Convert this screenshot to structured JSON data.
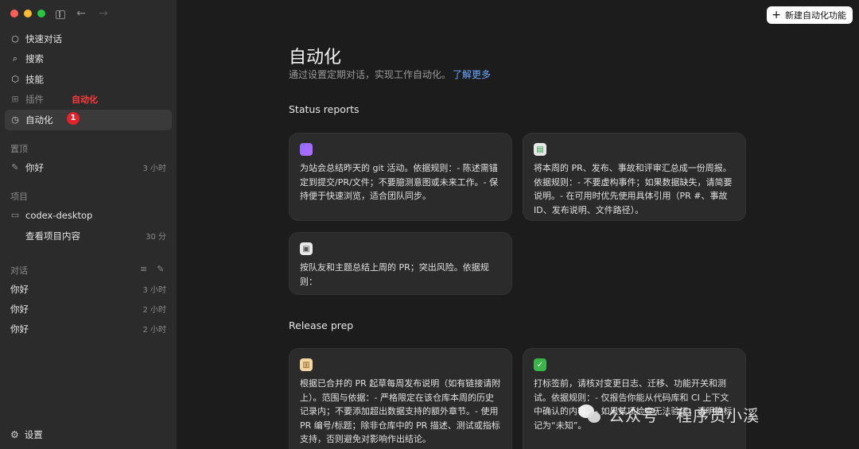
{
  "window": {
    "traffic_lights": [
      "#fe5f57",
      "#febc2e",
      "#28c840"
    ]
  },
  "sidebar": {
    "nav": [
      {
        "label": "快速对话",
        "icon": "chat-bubble-icon"
      },
      {
        "label": "搜索",
        "icon": "search-icon"
      },
      {
        "label": "技能",
        "icon": "cube-icon"
      },
      {
        "label": "插件",
        "icon": "grid-icon"
      },
      {
        "label": "自动化",
        "icon": "clock-icon"
      }
    ],
    "annotation_label": "自动化",
    "annotation_badge": "1",
    "pinned": {
      "header": "置顶",
      "items": [
        {
          "label": "你好",
          "meta": "3 小时"
        }
      ]
    },
    "projects": {
      "header": "项目",
      "items": [
        {
          "label": "codex-desktop",
          "meta": ""
        },
        {
          "label": "查看项目内容",
          "meta": "30 分"
        }
      ]
    },
    "conversations": {
      "header": "对话",
      "items": [
        {
          "label": "你好",
          "meta": "3 小时"
        },
        {
          "label": "你好",
          "meta": "2 小时"
        },
        {
          "label": "你好",
          "meta": "2 小时"
        }
      ]
    },
    "settings_label": "设置"
  },
  "main": {
    "new_button": "新建自动化功能",
    "title": "自动化",
    "subtitle": "通过设置定期对话，实现工作自动化。",
    "learn_more": "了解更多",
    "sections": [
      {
        "title": "Status reports",
        "cards": [
          {
            "icon": "purple-blob-icon",
            "text": "为站会总结昨天的 git 活动。依据规则：- 陈述需锚定到提交/PR/文件；不要臆测意图或未来工作。- 保持便于快速浏览，适合团队同步。"
          },
          {
            "icon": "document-icon",
            "text": "将本周的 PR、发布、事故和评审汇总成一份周报。依据规则：- 不要虚构事件；如果数据缺失，请简要说明。- 在可用时优先使用具体引用（PR #、事故 ID、发布说明、文件路径）。"
          },
          {
            "icon": "id-card-icon",
            "text": "按队友和主题总结上周的 PR；突出风险。依据规则："
          }
        ]
      },
      {
        "title": "Release prep",
        "cards": [
          {
            "icon": "book-icon",
            "text": "根据已合并的 PR 起草每周发布说明（如有链接请附上）。范围与依据：- 严格限定在该仓库本周的历史记录内；不要添加超出数据支持的额外章节。- 使用 PR 编号/标题；除非仓库中的 PR 描述、测试或指标支持，否则避免对影响作出结论。"
          },
          {
            "icon": "check-circle-icon",
            "text": "打标签前，请核对变更日志、迁移、功能开关和测试。依据规则：- 仅报告你能从代码库和 CI 上下文中确认的内容。- 如果某项检查无法验证，请明确标记为“未知”。"
          }
        ]
      }
    ]
  },
  "watermark": "公众号 · 程序员小溪"
}
